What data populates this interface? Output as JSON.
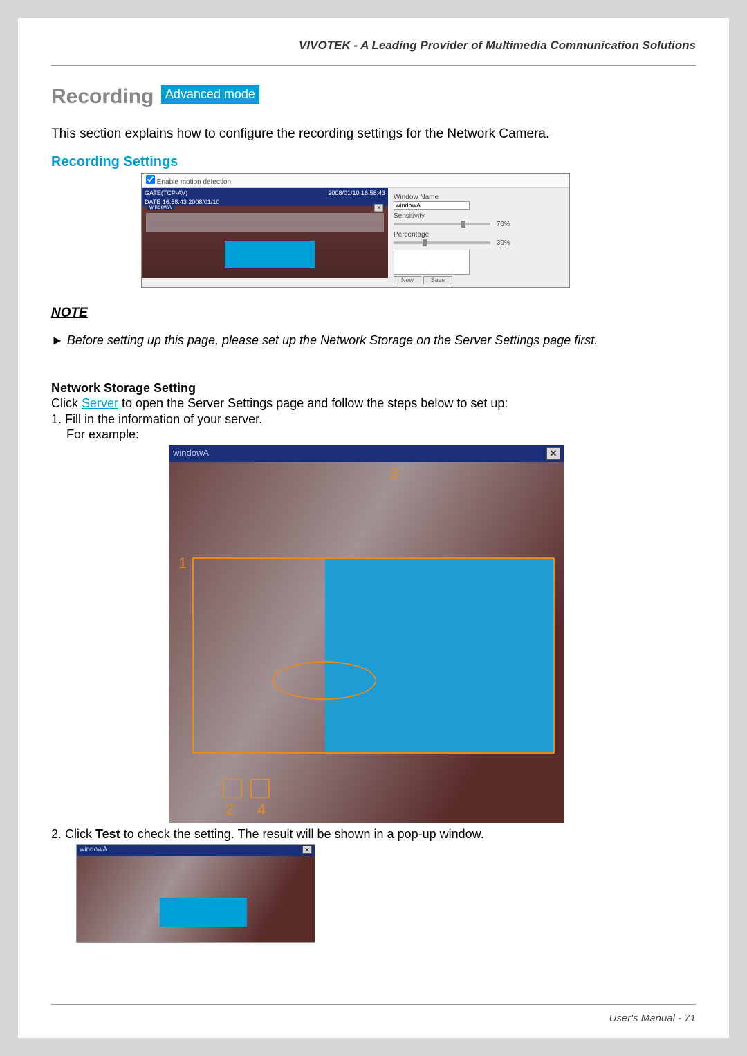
{
  "header": "VIVOTEK - A Leading Provider of Multimedia Communication Solutions",
  "title": "Recording",
  "badge": "Advanced mode",
  "intro": "This section explains how to configure the recording settings for the Network Camera.",
  "recordingSettings": {
    "heading": "Recording Settings",
    "enableLabel": "Enable motion detection",
    "previewBarLeft": "GATE(TCP-AV)",
    "previewBarRight": "2008/01/10 16:58:43",
    "previewBar2": "DATE 16:58:43 2008/01/10",
    "windowTitle": "windowA",
    "windowNameLabel": "Window Name",
    "windowNameValue": "windowA",
    "sensitivityLabel": "Sensitivity",
    "sensitivityValue": "70%",
    "percentageLabel": "Percentage",
    "percentageValue": "30%",
    "newBtn": "New",
    "saveBtn": "Save"
  },
  "note": {
    "heading": "NOTE",
    "body": "► Before setting up this page, please set up the Network Storage on the Server Settings page first."
  },
  "nss": {
    "heading": "Network Storage Setting",
    "line1a": "Click ",
    "serverLink": "Server",
    "line1b": " to open the Server Settings page and follow the steps below to set up:",
    "step1": "1. Fill in the information of your server.",
    "forExample": "For example:"
  },
  "shot2": {
    "title": "windowA",
    "a1": "1",
    "a2": "2",
    "a3": "3",
    "a4": "4"
  },
  "step2": "2. Click Test to check the setting. The result will be shown in a pop-up window.",
  "step2_a": "2. Click ",
  "step2_b": "Test",
  "step2_c": " to check the setting. The result will be shown in a pop-up window.",
  "shot3": {
    "title": "windowA"
  },
  "footer": "User's Manual - 71"
}
